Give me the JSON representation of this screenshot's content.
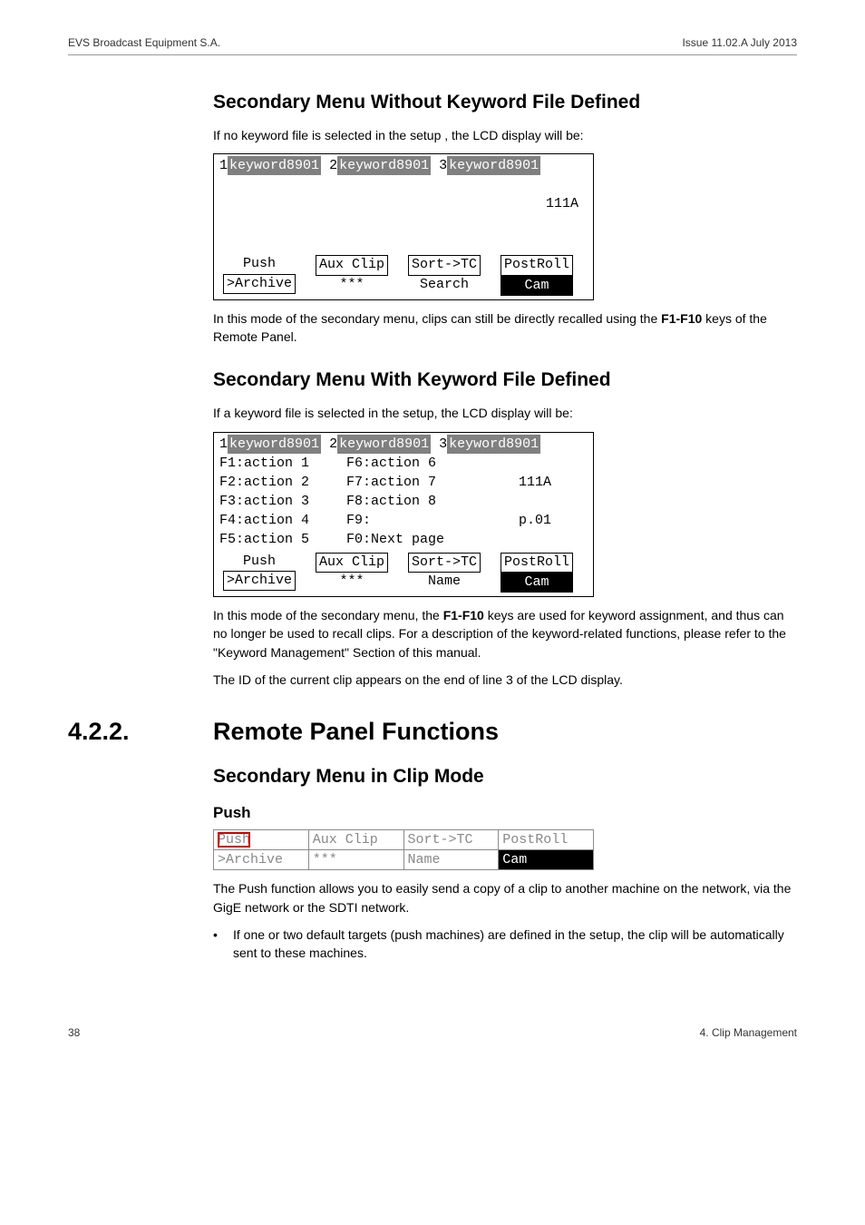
{
  "header": {
    "left": "EVS Broadcast Equipment S.A.",
    "right": "Issue 11.02.A  July 2013"
  },
  "s1": {
    "title": "Secondary Menu Without Keyword File Defined",
    "intro": "If no keyword file is selected in the setup , the LCD display will be:",
    "lcd": {
      "kw1_n": "1",
      "kw1": "keyword8901",
      "kw2_n": "2",
      "kw2": "keyword8901",
      "kw3_n": "3",
      "kw3": "keyword8901",
      "val": "111A",
      "row1_a": "Push",
      "row1_b": "Aux Clip",
      "row1_c": "Sort->TC",
      "row1_d": "PostRoll",
      "row2_a": ">Archive",
      "row2_b": "***",
      "row2_c": "Search",
      "row2_d": "Cam"
    },
    "after1": "In this mode of the secondary menu, clips can still be directly recalled using the ",
    "after_bold": "F1-F10",
    "after2": " keys of the Remote Panel."
  },
  "s2": {
    "title": "Secondary Menu With Keyword File Defined",
    "intro": "If a keyword file is selected in the setup, the LCD display will be:",
    "lcd": {
      "kw1_n": "1",
      "kw1": "keyword8901",
      "kw2_n": "2",
      "kw2": "keyword8901",
      "kw3_n": "3",
      "kw3": "keyword8901",
      "r2a": "F1:action 1",
      "r2b": "F6:action 6",
      "r3a": "F2:action 2",
      "r3b": "F7:action 7",
      "r3c": "111A",
      "r4a": "F3:action 3",
      "r4b": "F8:action 8",
      "r5a": "F4:action 4",
      "r5b": "F9:",
      "r5c": "p.01",
      "r6a": "F5:action 5",
      "r6b": "F0:Next page",
      "row1_a": "Push",
      "row1_b": "Aux Clip",
      "row1_c": "Sort->TC",
      "row1_d": "PostRoll",
      "row2_a": ">Archive",
      "row2_b": "***",
      "row2_c": "Name",
      "row2_d": "Cam"
    },
    "after1": "In this mode of the secondary menu, the ",
    "after_bold": "F1-F10",
    "after2": " keys are used for keyword assignment, and thus can no longer be used to recall clips. For a description of the keyword-related functions, please refer to the \"Keyword Management\" Section of this manual.",
    "after3": "The ID of the current clip appears on the end of line 3 of the LCD display."
  },
  "s3": {
    "num": "4.2.2.",
    "title": "Remote Panel Functions",
    "sub": "Secondary Menu in Clip Mode",
    "push": "Push",
    "tbl": {
      "r1a": "Push",
      "r1b": "Aux Clip",
      "r1c": "Sort->TC",
      "r1d": "PostRoll",
      "r2a": ">Archive",
      "r2b": "***",
      "r2c": "Name",
      "r2d": "Cam"
    },
    "p1": "The Push function allows you to easily send a copy of a clip to another machine on the network, via the GigE network or the SDTI network.",
    "bullet": "If one or two default targets (push machines) are defined in the setup, the clip will be automatically sent to these machines."
  },
  "footer": {
    "left": "38",
    "right": "4. Clip Management"
  }
}
